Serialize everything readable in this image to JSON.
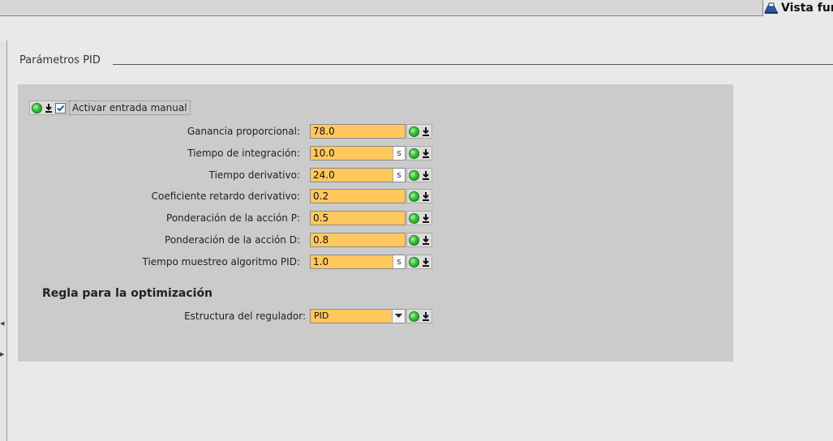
{
  "header": {
    "view_label": "Vista fur"
  },
  "section": {
    "title": "Parámetros PID"
  },
  "manual": {
    "label": "Activar entrada manual",
    "checked": true
  },
  "params": [
    {
      "label": "Ganancia proporcional:",
      "value": "78.0",
      "unit": ""
    },
    {
      "label": "Tiempo de integración:",
      "value": "10.0",
      "unit": "s"
    },
    {
      "label": "Tiempo derivativo:",
      "value": "24.0",
      "unit": "s"
    },
    {
      "label": "Coeficiente retardo derivativo:",
      "value": "0.2",
      "unit": ""
    },
    {
      "label": "Ponderación de la acción P:",
      "value": "0.5",
      "unit": ""
    },
    {
      "label": "Ponderación de la acción D:",
      "value": "0.8",
      "unit": ""
    },
    {
      "label": "Tiempo muestreo algoritmo PID:",
      "value": "1.0",
      "unit": "s"
    }
  ],
  "optimization": {
    "heading": "Regla para la optimización",
    "structure_label": "Estructura del regulador:",
    "structure_value": "PID"
  },
  "icons": {
    "status": "green-status-led-icon",
    "download": "download-arrow-icon",
    "view": "view-switch-icon",
    "dropdown": "chevron-down-icon"
  },
  "colors": {
    "field_bg": "#ffc85e",
    "panel_bg": "#cbcbcb",
    "page_bg": "#e9e9e9",
    "led_green": "#35c335"
  }
}
